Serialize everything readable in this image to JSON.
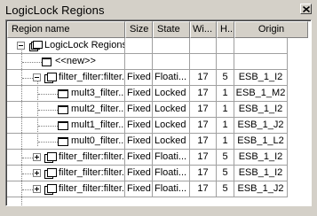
{
  "window": {
    "title": "LogicLock Regions"
  },
  "icons": {
    "close": "close-icon",
    "expand": "plus-box-icon",
    "collapse": "minus-box-icon",
    "region": "region-icon"
  },
  "columns": [
    "Region name",
    "Size",
    "State",
    "Wi...",
    "H...",
    "Origin"
  ],
  "rows": [
    {
      "name": "LogicLock Regions",
      "size": "",
      "state": "",
      "width": "",
      "height": "",
      "origin": ""
    },
    {
      "name": "<<new>>",
      "size": "",
      "state": "",
      "width": "",
      "height": "",
      "origin": ""
    },
    {
      "name": "filter_filter:filter...",
      "size": "Fixed",
      "state": "Floati...",
      "width": "17",
      "height": "5",
      "origin": "ESB_1_I2"
    },
    {
      "name": "mult3_filter...",
      "size": "Fixed",
      "state": "Locked",
      "width": "17",
      "height": "1",
      "origin": "ESB_1_M2"
    },
    {
      "name": "mult2_filter...",
      "size": "Fixed",
      "state": "Locked",
      "width": "17",
      "height": "1",
      "origin": "ESB_1_I2"
    },
    {
      "name": "mult1_filter...",
      "size": "Fixed",
      "state": "Locked",
      "width": "17",
      "height": "1",
      "origin": "ESB_1_J2"
    },
    {
      "name": "mult0_filter...",
      "size": "Fixed",
      "state": "Locked",
      "width": "17",
      "height": "1",
      "origin": "ESB_1_L2"
    },
    {
      "name": "filter_filter:filter...",
      "size": "Fixed",
      "state": "Floati...",
      "width": "17",
      "height": "5",
      "origin": "ESB_1_I2"
    },
    {
      "name": "filter_filter:filter...",
      "size": "Fixed",
      "state": "Floati...",
      "width": "17",
      "height": "5",
      "origin": "ESB_1_I2"
    },
    {
      "name": "filter_filter:filter...",
      "size": "Fixed",
      "state": "Floati...",
      "width": "17",
      "height": "5",
      "origin": "ESB_1_J2"
    }
  ]
}
